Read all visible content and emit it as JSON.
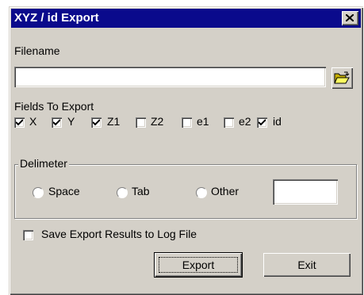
{
  "window": {
    "title": "XYZ / id Export",
    "close_icon": "close-icon"
  },
  "filename": {
    "label": "Filename",
    "value": "",
    "browse_icon": "folder-open-icon"
  },
  "fields": {
    "label": "Fields To Export",
    "items": [
      {
        "label": "X",
        "checked": true
      },
      {
        "label": "Y",
        "checked": true
      },
      {
        "label": "Z1",
        "checked": true
      },
      {
        "label": "Z2",
        "checked": false
      },
      {
        "label": "e1",
        "checked": false
      },
      {
        "label": "e2",
        "checked": false
      },
      {
        "label": "id",
        "checked": true
      }
    ]
  },
  "delimiter": {
    "label": "Delimeter",
    "options": [
      {
        "label": "Space",
        "selected": false
      },
      {
        "label": "Tab",
        "selected": false
      },
      {
        "label": "Other",
        "selected": false
      }
    ],
    "other_value": ""
  },
  "log": {
    "label": "Save Export Results to Log File",
    "checked": false
  },
  "buttons": {
    "export": "Export",
    "exit": "Exit"
  },
  "colors": {
    "titlebar": "#0a0a8c",
    "face": "#d4d0c8"
  }
}
